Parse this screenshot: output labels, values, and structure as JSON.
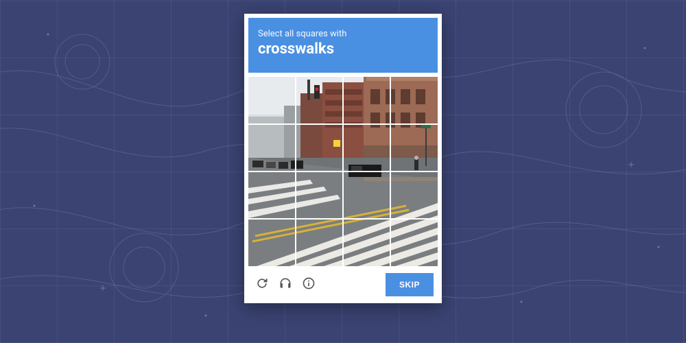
{
  "header": {
    "instruction_line1": "Select all squares with",
    "target": "crosswalks"
  },
  "grid": {
    "rows": 4,
    "cols": 4
  },
  "footer": {
    "skip_label": "SKIP",
    "icons": {
      "refresh": "refresh-icon",
      "audio": "headphones-icon",
      "info": "info-icon"
    }
  },
  "colors": {
    "accent": "#4a90e2",
    "panel": "#ffffff",
    "background": "#3a4372"
  }
}
